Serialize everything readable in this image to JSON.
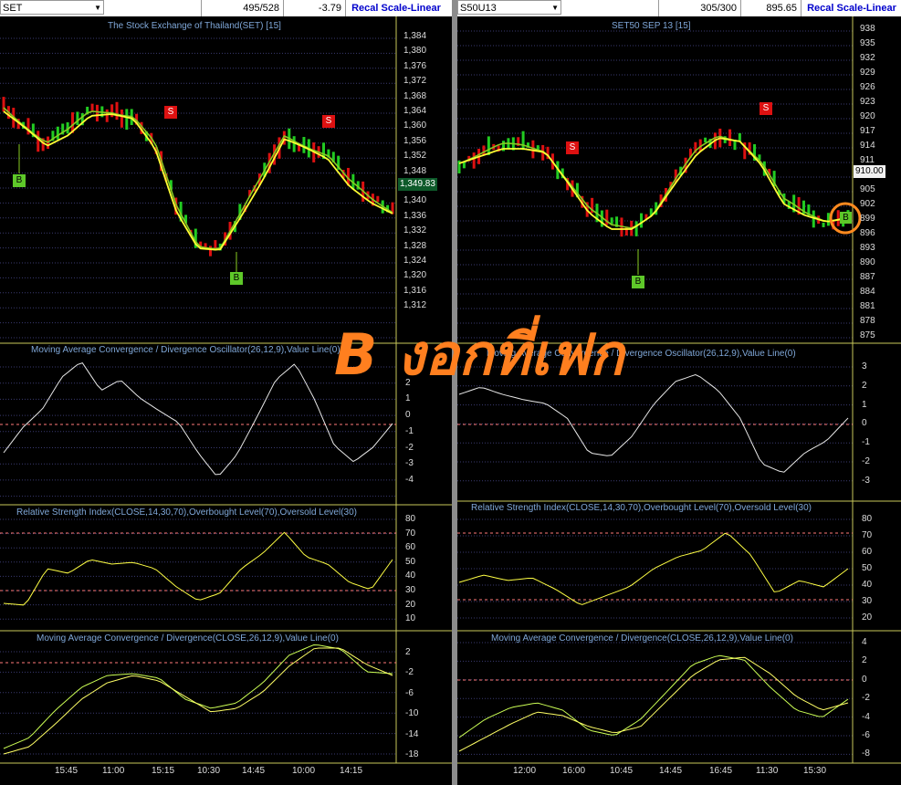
{
  "colors": {
    "grid": "#3a3a70",
    "frame": "#c8c85a",
    "up": "#22cc22",
    "down": "#dd1111",
    "ma_fast": "#88cc22",
    "ma_slow": "#ffff33",
    "osc": "#e8e8e8",
    "rsi": "#ffff44",
    "macd_a": "#ccff55",
    "macd_b": "#ffff66",
    "level": "#ff7a7a",
    "title": "#7fa7d8",
    "stamp": "#ff7f1f"
  },
  "left": {
    "symbol": "SET",
    "count": "495/528",
    "change": "-3.79",
    "recal": "Recal Scale-Linear",
    "price_title": "The Stock Exchange of Thailand(SET) [15]",
    "last_price": "1,349.83",
    "osc_title": "Moving Average Convergence / Divergence Oscillator(26,12,9),Value Line(0)",
    "rsi_title": "Relative Strength Index(CLOSE,14,30,70),Overbought Level(70),Oversold Level(30)",
    "macd_title": "Moving Average Convergence / Divergence(CLOSE,26,12,9),Value Line(0)",
    "price_ticks": [
      "1,384",
      "1,380",
      "1,376",
      "1,372",
      "1,368",
      "1,364",
      "1,360",
      "1,356",
      "1,352",
      "1,348",
      "1,344",
      "1,340",
      "1,336",
      "1,332",
      "1,328",
      "1,324",
      "1,320",
      "1,316",
      "1,312"
    ],
    "osc_ticks": [
      "3",
      "2",
      "1",
      "0",
      "-1",
      "-2",
      "-3",
      "-4"
    ],
    "rsi_ticks": [
      "80",
      "70",
      "60",
      "50",
      "40",
      "30",
      "20",
      "10"
    ],
    "macd_ticks": [
      "2",
      "-2",
      "-6",
      "-10",
      "-14",
      "-18"
    ],
    "time_ticks": [
      "15:45",
      "11:00",
      "15:15",
      "10:30",
      "14:45",
      "10:00",
      "14:15"
    ],
    "signals": {
      "b1": "B",
      "b2": "B",
      "s1": "S",
      "s2": "S"
    }
  },
  "right": {
    "symbol": "S50U13",
    "count": "305/300",
    "change": "895.65",
    "recal": "Recal Scale-Linear",
    "price_title": "SET50 SEP 13   [15]",
    "last_price": "910.00",
    "osc_title": "Moving Average Convergence / Divergence Oscillator(26,12,9),Value Line(0)",
    "rsi_title": "Relative Strength Index(CLOSE,14,30,70),Overbought Level(70),Oversold Level(30)",
    "macd_title": "Moving Average Convergence / Divergence(CLOSE,26,12,9),Value Line(0)",
    "price_ticks": [
      "938",
      "935",
      "932",
      "929",
      "926",
      "923",
      "920",
      "917",
      "914",
      "911",
      "908",
      "905",
      "902",
      "899",
      "896",
      "893",
      "890",
      "887",
      "884",
      "881",
      "878",
      "875"
    ],
    "osc_ticks": [
      "3",
      "2",
      "1",
      "0",
      "-1",
      "-2",
      "-3"
    ],
    "rsi_ticks": [
      "80",
      "70",
      "60",
      "50",
      "40",
      "30",
      "20"
    ],
    "macd_ticks": [
      "4",
      "2",
      "0",
      "-2",
      "-4",
      "-6",
      "-8"
    ],
    "time_ticks": [
      "12:00",
      "16:00",
      "10:45",
      "14:45",
      "16:45",
      "11:30",
      "15:30"
    ],
    "signals": {
      "s1": "S",
      "b1": "B",
      "s2": "S",
      "b2": "B"
    }
  },
  "stamp_text": "B งอกที่เฟก"
}
